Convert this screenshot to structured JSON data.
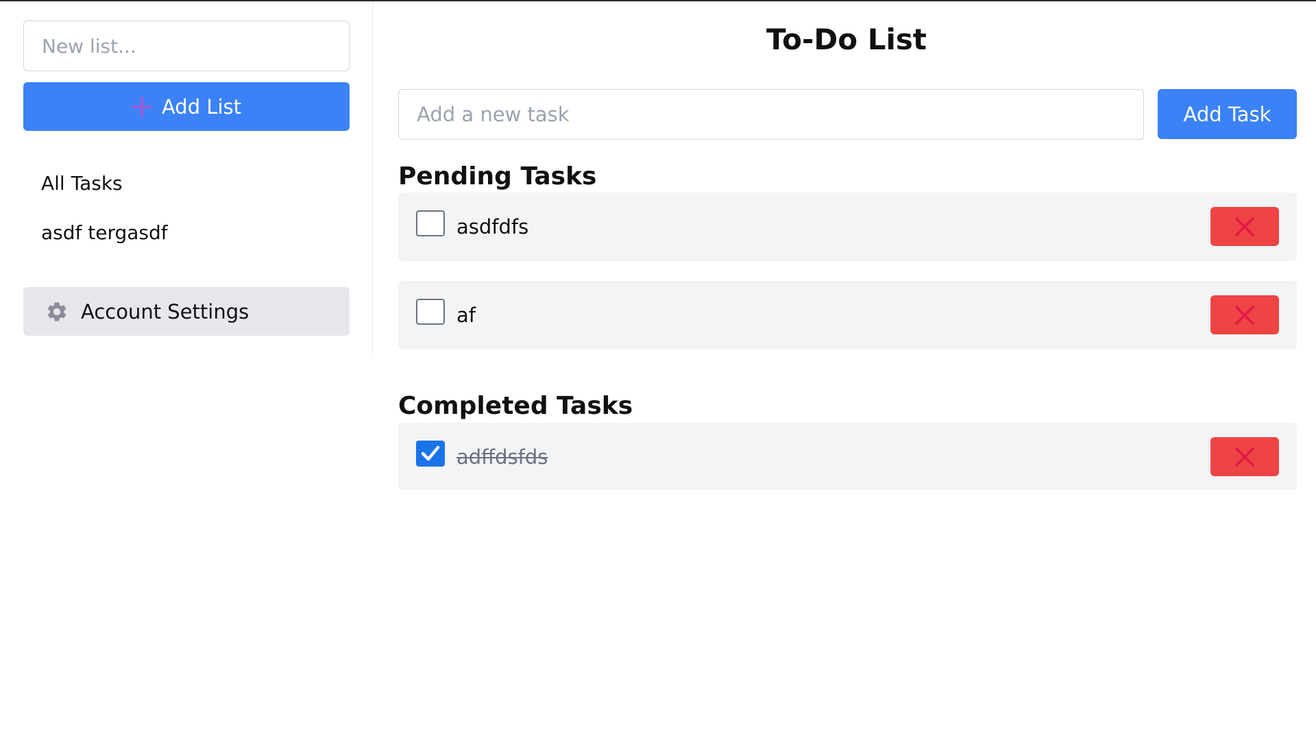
{
  "sidebar": {
    "new_list_placeholder": "New list...",
    "add_list_label": "Add List",
    "lists": [
      {
        "label": "All Tasks"
      },
      {
        "label": "asdf tergasdf"
      }
    ],
    "settings_label": "Account Settings"
  },
  "main": {
    "title": "To-Do List",
    "task_input_placeholder": "Add a new task",
    "add_task_label": "Add Task",
    "pending": {
      "heading": "Pending Tasks",
      "tasks": [
        {
          "text": "asdfdfs",
          "checked": false
        },
        {
          "text": "af",
          "checked": false
        }
      ]
    },
    "completed": {
      "heading": "Completed Tasks",
      "tasks": [
        {
          "text": "adffdsfds",
          "checked": true
        }
      ]
    }
  },
  "icons": {
    "add_list": "plus-icon",
    "settings": "gear-icon",
    "delete": "close-icon",
    "checked": "check-icon"
  },
  "colors": {
    "primary": "#3b82f6",
    "danger": "#ef4444",
    "danger_icon": "#e11d48",
    "checkbox_checked": "#1a73e8",
    "row_background": "#f3f4f6",
    "settings_background": "#e5e7eb",
    "plus_icon": "#9a5cd6"
  }
}
